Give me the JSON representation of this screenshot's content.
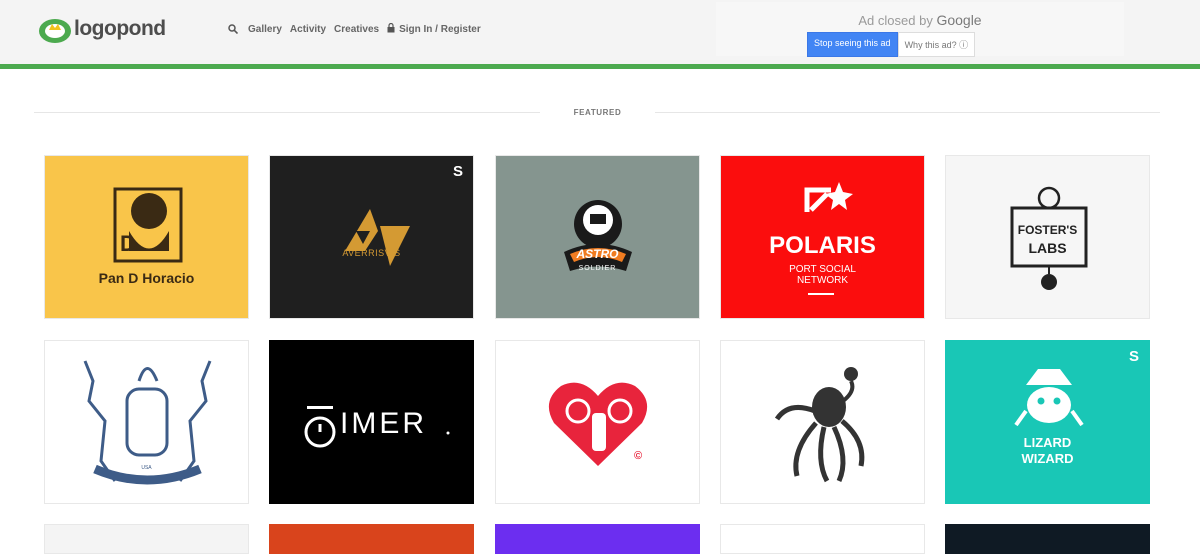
{
  "header": {
    "logo_text": "logopond",
    "nav": {
      "gallery": "Gallery",
      "activity": "Activity",
      "creatives": "Creatives",
      "signin": "Sign In / Register"
    }
  },
  "ad": {
    "closed_prefix": "Ad closed by",
    "closed_brand": "Google",
    "stop_label": "Stop seeing this ad",
    "why_label": "Why this ad? ⓘ"
  },
  "section": {
    "title": "FEATURED"
  },
  "colors": {
    "accent_green": "#4caa4f",
    "ad_button_blue": "#4285f4"
  },
  "tiles": [
    {
      "bg": "#f9c54a",
      "text": "Pan D Horacio",
      "icon": "chef-portrait-icon"
    },
    {
      "bg": "#1f1f1f",
      "text": "AVERRISVIS",
      "icon": "triangle-shape-icon",
      "badge": "S"
    },
    {
      "bg": "#85958f",
      "text": "ASTRO",
      "sub": "SOLDIER",
      "icon": "astronaut-helmet-icon"
    },
    {
      "bg": "#fb0d0d",
      "text": "POLARIS",
      "sub": "PORT SOCIAL",
      "sub2": "NETWORK",
      "icon": "star-arrow-icon"
    },
    {
      "bg": "#f6f6f6",
      "text": "FOSTER'S",
      "sub": "LABS",
      "icon": "lab-emblem-icon"
    },
    {
      "bg": "#ffffff",
      "text": "FT COLLINS ✦ COLORADO",
      "sub": "USA",
      "icon": "elk-crest-icon"
    },
    {
      "bg": "#000000",
      "text": "IMER",
      "icon": "stopwatch-icon"
    },
    {
      "bg": "#ffffff",
      "text": "©",
      "icon": "heart-fist-icon"
    },
    {
      "bg": "#ffffff",
      "text": "",
      "icon": "octopus-icon"
    },
    {
      "bg": "#19c7b6",
      "text": "LIZARD",
      "sub": "WIZARD",
      "icon": "lizard-wizard-icon",
      "badge": "S"
    },
    {
      "bg": "#f4f4f4"
    },
    {
      "bg": "#d9441c"
    },
    {
      "bg": "#6c2ef0"
    },
    {
      "bg": "#ffffff"
    },
    {
      "bg": "#0f1a24"
    }
  ]
}
